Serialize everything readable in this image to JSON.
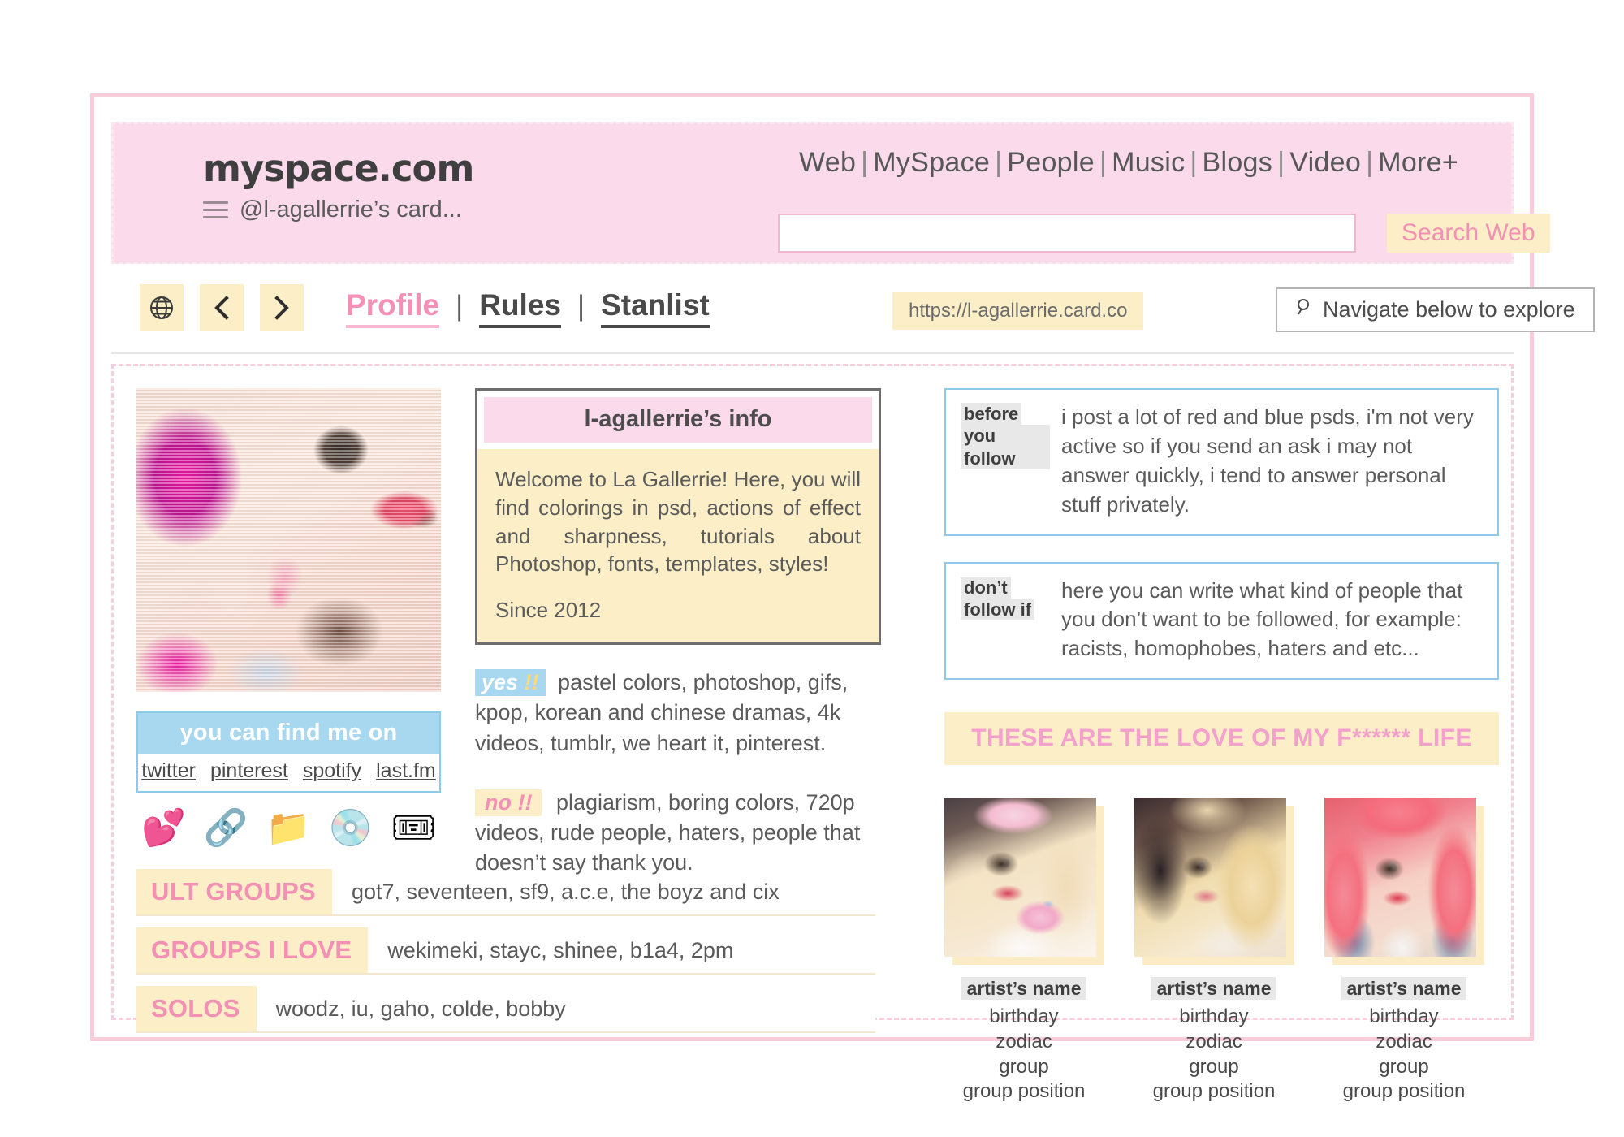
{
  "frame": {
    "accent_pink": "#f8cdd9",
    "accent_cream": "#fcefc7",
    "accent_blue": "#a8d8ef"
  },
  "header": {
    "logo": "myspace.com",
    "handle": "@l-agallerrie’s card...",
    "nav_items": [
      "Web",
      "MySpace",
      "People",
      "Music",
      "Blogs",
      "Video",
      "More+"
    ],
    "nav_separator": "|",
    "search_value": "",
    "search_placeholder": "",
    "search_button": "Search Web"
  },
  "toolbar": {
    "globe_icon": "globe-icon",
    "back_icon": "chevron-left-icon",
    "forward_icon": "chevron-right-icon",
    "tabs": [
      {
        "label": "Profile",
        "active": true
      },
      {
        "label": "Rules",
        "active": false
      },
      {
        "label": "Stanlist",
        "active": false
      }
    ],
    "tab_separator": "|",
    "url": "https://l-agallerrie.card.co",
    "navigate_label": "Navigate below to explore",
    "navigate_icon": "search-icon"
  },
  "left_column": {
    "profile_photo_alt": "profile-photo",
    "find_me": {
      "title": "you can find me on",
      "links": [
        "twitter",
        "pinterest",
        "spotify",
        "last.fm"
      ]
    },
    "emoji_icons": [
      {
        "name": "two-hearts-icon",
        "glyph": "💕"
      },
      {
        "name": "link-icon",
        "glyph": "🔗"
      },
      {
        "name": "folder-icon",
        "glyph": "📁"
      },
      {
        "name": "compact-disc-icon",
        "glyph": "💿"
      },
      {
        "name": "admission-ticket-icon",
        "glyph": "🎟"
      }
    ]
  },
  "group_rows": [
    {
      "key": "ULT GROUPS",
      "value": "got7, seventeen, sf9, a.c.e, the boyz and cix"
    },
    {
      "key": "GROUPS I LOVE",
      "value": "wekimeki, stayc, shinee, b1a4, 2pm"
    },
    {
      "key": "SOLOS",
      "value": "woodz, iu, gaho, colde, bobby"
    }
  ],
  "info_card": {
    "title": "l-agallerrie’s info",
    "paragraph1": "Welcome to La Gallerrie! Here, you will find colorings in psd, actions of effect and sharpness, tutorials about Photoshop, fonts, templates, styles!",
    "paragraph2": "Since 2012"
  },
  "yes_no": {
    "yes_tag_text": "yes ",
    "yes_tag_marks": "!!",
    "yes_text": " pastel colors, photoshop, gifs, kpop, korean and chinese dramas, 4k videos, tumblr, we heart it, pinterest.",
    "no_tag": "no !!",
    "no_text": " plagiarism, boring colors, 720p videos, rude people, haters, people that doesn’t say thank you."
  },
  "rules": [
    {
      "tag_line1": "before",
      "tag_line2": "you follow",
      "text": "i post a lot of red and blue psds, i'm not very active so if you send an ask i may not answer quickly, i tend to answer personal stuff privately."
    },
    {
      "tag_line1": "don’t",
      "tag_line2": "follow if",
      "text": "here you can write what kind of people that you don’t want to be followed, for example: racists, homophobes, haters and etc..."
    }
  ],
  "love_banner": "THESE ARE THE LOVE OF MY F****** LIFE",
  "artists": [
    {
      "name": "artist’s name",
      "birthday": "birthday",
      "zodiac": "zodiac",
      "group": "group",
      "position": "group position"
    },
    {
      "name": "artist’s name",
      "birthday": "birthday",
      "zodiac": "zodiac",
      "group": "group",
      "position": "group position"
    },
    {
      "name": "artist’s name",
      "birthday": "birthday",
      "zodiac": "zodiac",
      "group": "group",
      "position": "group position"
    }
  ]
}
